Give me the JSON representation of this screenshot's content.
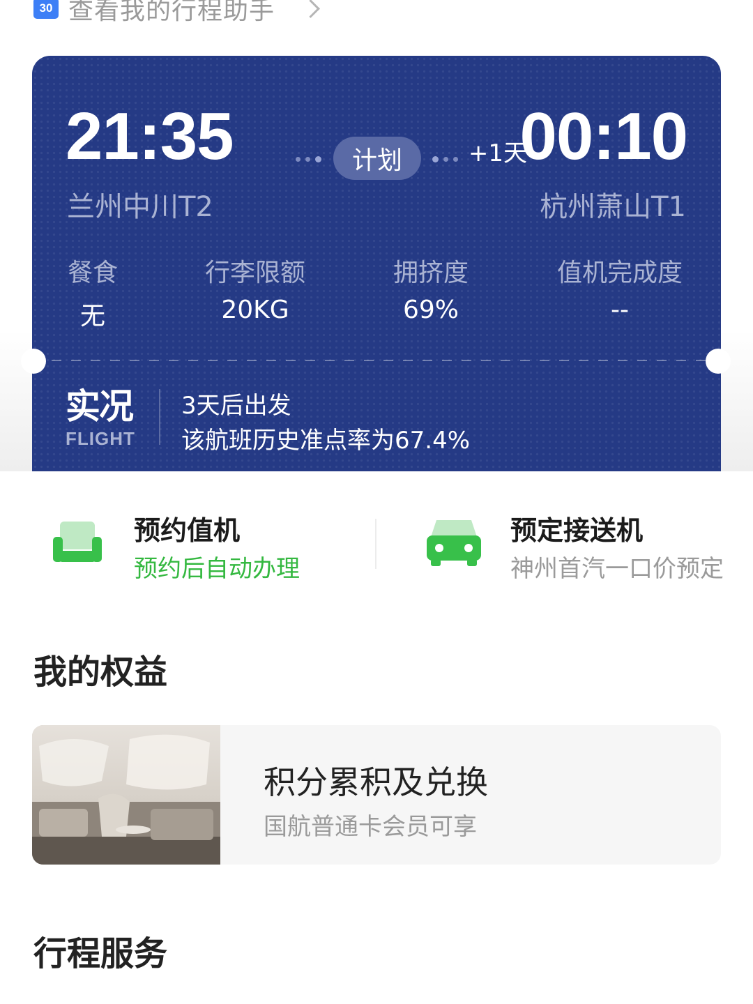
{
  "helper": {
    "calendar_day": "30",
    "label": "查看我的行程助手"
  },
  "flight": {
    "departure_time": "21:35",
    "departure_airport": "兰州中川T2",
    "arrival_time": "00:10",
    "arrival_day_offset": "+1天",
    "arrival_airport": "杭州萧山T1",
    "status": "计划",
    "stats": [
      {
        "label": "餐食",
        "value": "无"
      },
      {
        "label": "行李限额",
        "value": "20KG"
      },
      {
        "label": "拥挤度",
        "value": "69%"
      },
      {
        "label": "值机完成度",
        "value": "--"
      }
    ],
    "live": {
      "logo_cn": "实况",
      "logo_en": "FLIGHT",
      "departure_note": "3天后出发",
      "ontime_note": "该航班历史准点率为67.4%"
    }
  },
  "services": [
    {
      "title": "预约值机",
      "subtitle": "预约后自动办理",
      "icon": "seat-icon",
      "subtitle_color": "#34b840"
    },
    {
      "title": "预定接送机",
      "subtitle": "神州首汽一口价预定",
      "icon": "car-icon",
      "subtitle_color": "#9a9a9a"
    }
  ],
  "benefits": {
    "title": "我的权益",
    "card": {
      "name": "积分累积及兑换",
      "subtitle": "国航普通卡会员可享"
    }
  },
  "trip_services": {
    "title": "行程服务"
  },
  "colors": {
    "card_bg": "#253a85",
    "accent_green": "#34b840",
    "calendar_blue": "#3d7ff6"
  }
}
